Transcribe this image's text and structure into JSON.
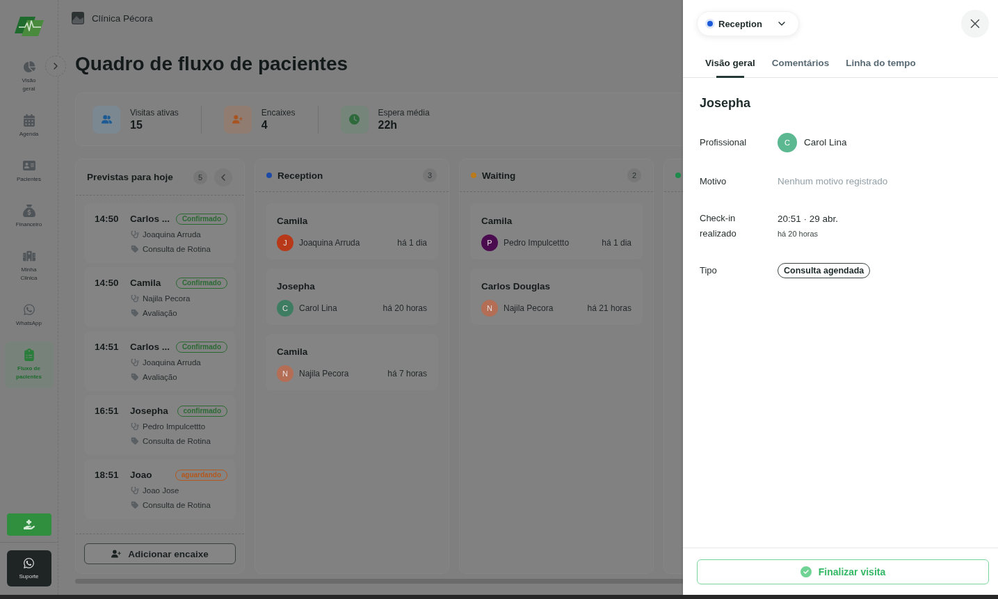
{
  "sidebar": {
    "items": [
      {
        "label": "Visão geral",
        "selected": false
      },
      {
        "label": "Agenda",
        "selected": false
      },
      {
        "label": "Pacientes",
        "selected": false
      },
      {
        "label": "Financeiro",
        "selected": false
      },
      {
        "label": "Minha Clinica",
        "selected": false
      },
      {
        "label": "WhatsApp",
        "selected": false
      },
      {
        "label": "Fluxo de pacientes",
        "selected": true
      }
    ],
    "support_button": "Suporte"
  },
  "header": {
    "clinic_name": "Clínica Pécora"
  },
  "page_title": "Quadro de fluxo de pacientes",
  "stats": [
    {
      "label": "Visitas ativas",
      "value": "15"
    },
    {
      "label": "Encaixes",
      "value": "4"
    },
    {
      "label": "Espera média",
      "value": "22h"
    }
  ],
  "scheduled_today": {
    "title": "Previstas para hoje",
    "count": "5",
    "appointments": [
      {
        "time": "14:50",
        "patient": "Carlos ...",
        "status": {
          "label": "Confirmado",
          "color": "#2b6a33"
        },
        "professional": "Joaquina Arruda",
        "type": "Consulta de Rotina"
      },
      {
        "time": "14:50",
        "patient": "Camila",
        "status": {
          "label": "Confirmado",
          "color": "#2b6a33"
        },
        "professional": "Najila Pecora",
        "type": "Avaliação"
      },
      {
        "time": "14:51",
        "patient": "Carlos ...",
        "status": {
          "label": "Confirmado",
          "color": "#2b6a33"
        },
        "professional": "Joaquina Arruda",
        "type": "Avaliação"
      },
      {
        "time": "16:51",
        "patient": "Josepha",
        "status": {
          "label": "confirmado",
          "color": "#2b6a33"
        },
        "professional": "Pedro Impulcettto",
        "type": "Consulta de Rotina"
      },
      {
        "time": "18:51",
        "patient": "Joao",
        "status": {
          "label": "aguardando",
          "color": "#b5581c"
        },
        "professional": "Joao Jose",
        "type": "Consulta de Rotina"
      }
    ],
    "add_button": "Adicionar encaixe"
  },
  "columns": [
    {
      "title": "Reception",
      "color": "#1c4aa6",
      "count": "3",
      "cards": [
        {
          "patient": "Camila",
          "professional": {
            "name": "Joaquina Arruda",
            "initial": "J",
            "color": "#b8391a"
          },
          "elapsed": "há 1 dia"
        },
        {
          "patient": "Josepha",
          "professional": {
            "name": "Carol Lina",
            "initial": "C",
            "color": "#3f7d62"
          },
          "elapsed": "há 20 horas"
        },
        {
          "patient": "Camila",
          "professional": {
            "name": "Najila Pecora",
            "initial": "N",
            "color": "#b46e55"
          },
          "elapsed": "há 7 horas"
        }
      ]
    },
    {
      "title": "Waiting",
      "color": "#bb7a1c",
      "count": "2",
      "cards": [
        {
          "patient": "Camila",
          "professional": {
            "name": "Pedro Impulcettto",
            "initial": "P",
            "color": "#4b0b4f"
          },
          "elapsed": "há 1 dia"
        },
        {
          "patient": "Carlos Douglas",
          "professional": {
            "name": "Najila Pecora",
            "initial": "N",
            "color": "#b46e55"
          },
          "elapsed": "há 21 horas"
        }
      ]
    },
    {
      "color": "#1e8a4c"
    }
  ],
  "drawer": {
    "status": {
      "label": "Reception",
      "color": "#1a5ad8"
    },
    "tabs": [
      {
        "label": "Visão geral",
        "selected": true
      },
      {
        "label": "Comentários",
        "selected": false
      },
      {
        "label": "Linha do tempo",
        "selected": false
      }
    ],
    "patient": "Josepha",
    "fields": [
      {
        "kind": "professional",
        "label": "Profissional",
        "value": "Carol Lina",
        "initial": "C",
        "color": "#5bb891"
      },
      {
        "kind": "empty",
        "label": "Motivo",
        "value": "Nenhum motivo registrado"
      },
      {
        "kind": "datetime",
        "label": "Check-in realizado",
        "value": "20:51 · 29 abr.",
        "subvalue": "há 20 horas"
      },
      {
        "kind": "chip",
        "label": "Tipo",
        "value": "Consulta agendada"
      }
    ],
    "finish_button": "Finalizar visita"
  }
}
